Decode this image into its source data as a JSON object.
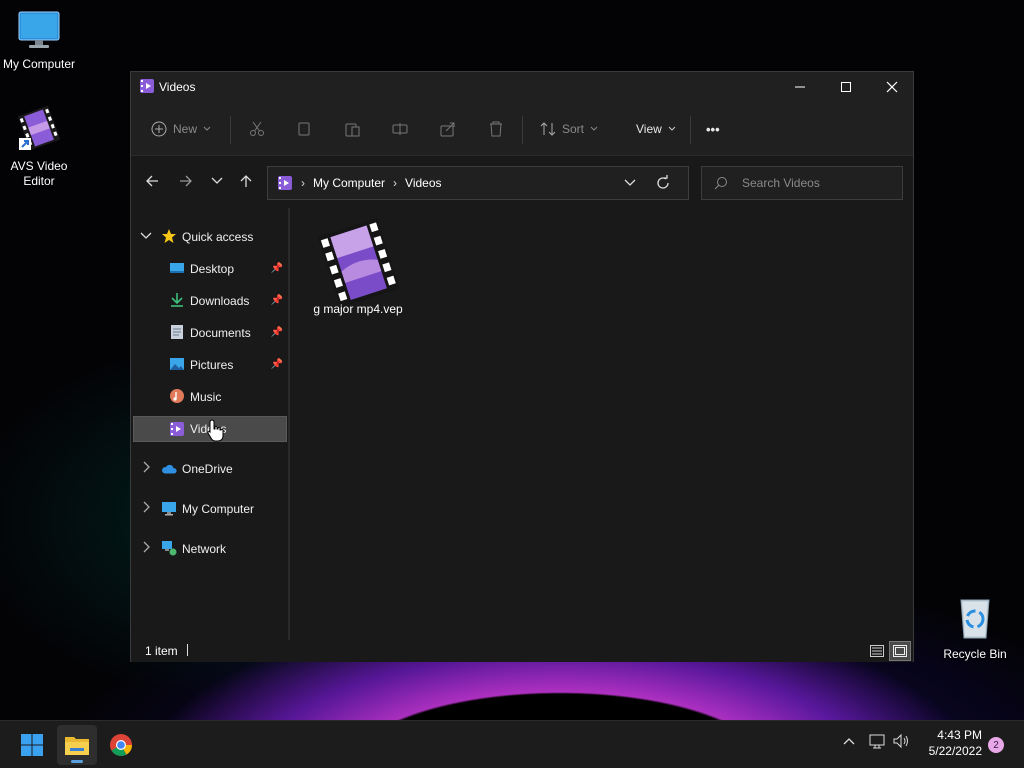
{
  "desktop": {
    "icons": [
      {
        "label": "My Computer"
      },
      {
        "label": "AVS Video Editor"
      },
      {
        "label": "Recycle Bin"
      }
    ]
  },
  "window": {
    "title": "Videos",
    "toolbar": {
      "new_label": "New",
      "sort_label": "Sort",
      "view_label": "View",
      "more_label": "•••"
    },
    "address": {
      "crumbs": [
        "My Computer",
        "Videos"
      ],
      "separator": "›"
    },
    "search": {
      "placeholder": "Search Videos"
    },
    "sidebar": {
      "quick_access": "Quick access",
      "items": [
        {
          "label": "Desktop",
          "pinned": true
        },
        {
          "label": "Downloads",
          "pinned": true
        },
        {
          "label": "Documents",
          "pinned": true
        },
        {
          "label": "Pictures",
          "pinned": true
        },
        {
          "label": "Music",
          "pinned": false
        },
        {
          "label": "Videos",
          "pinned": false
        }
      ],
      "roots": [
        {
          "label": "OneDrive"
        },
        {
          "label": "My Computer"
        },
        {
          "label": "Network"
        }
      ]
    },
    "files": [
      {
        "name": "g major mp4.vep"
      }
    ],
    "status": {
      "count": "1 item"
    }
  },
  "taskbar": {
    "time": "4:43 PM",
    "date": "5/22/2022",
    "notifications": "2"
  },
  "colors": {
    "accent_purple": "#7b4fd6",
    "selection": "#4a4a4a",
    "win_blue": "#3aa0f0"
  }
}
